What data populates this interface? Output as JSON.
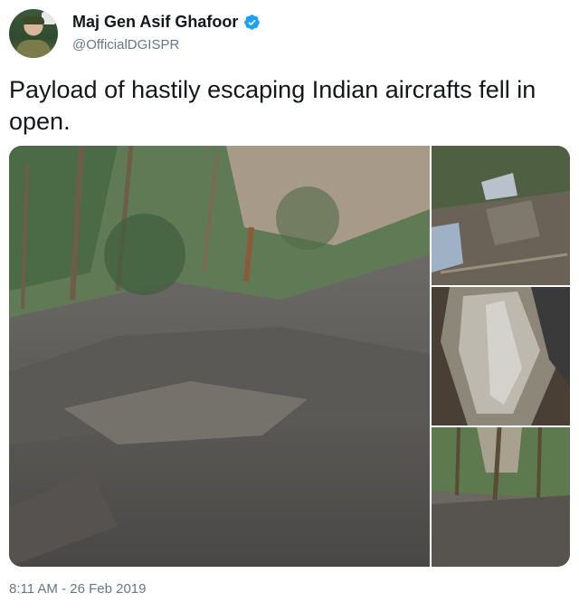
{
  "author": {
    "display_name": "Maj Gen Asif Ghafoor",
    "handle": "@OfficialDGISPR",
    "verified": true,
    "avatar_icon": "avatar-military-officer"
  },
  "tweet": {
    "text": "Payload of hastily escaping Indian aircrafts fell in open.",
    "timestamp": "8:11 AM - 26 Feb 2019"
  },
  "media": {
    "photo_count": 4
  },
  "colors": {
    "verified_blue": "#1da1f2",
    "secondary_text": "#657786",
    "primary_text": "#14171a"
  }
}
